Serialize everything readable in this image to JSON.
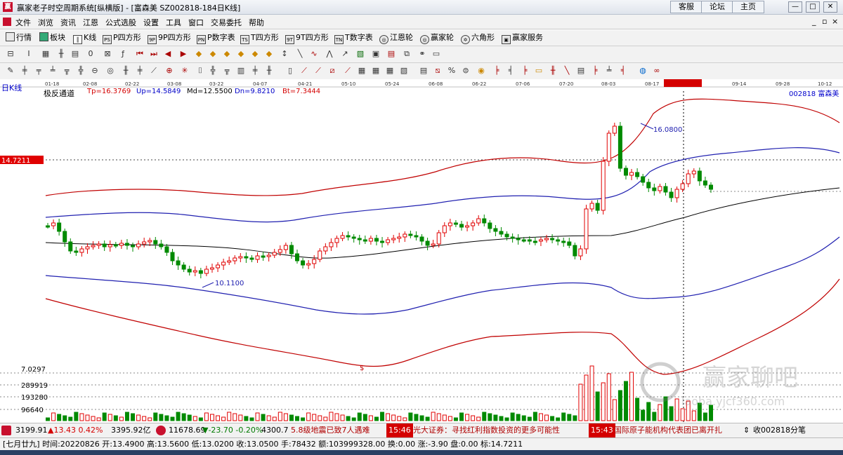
{
  "window": {
    "title": "赢家老子时空周期系统[纵横版] - [富森美  SZ002818-184日K线]",
    "buttons": [
      "客服",
      "论坛",
      "主页"
    ],
    "controls": [
      "—",
      "□",
      "✕"
    ]
  },
  "menu": [
    "文件",
    "浏览",
    "资讯",
    "江恩",
    "公式选股",
    "设置",
    "工具",
    "窗口",
    "交易委托",
    "帮助"
  ],
  "mdi_controls": [
    "_",
    "▫",
    "×"
  ],
  "toolbar1": [
    {
      "label": "行情",
      "icon": "grid-icon"
    },
    {
      "label": "板块",
      "icon": "blocks-icon"
    },
    {
      "label": "K线",
      "icon": "candle-icon"
    },
    {
      "label": "P四方形",
      "icon": "p-square-icon",
      "glyph": "PS"
    },
    {
      "label": "9P四方形",
      "icon": "9p-square-icon",
      "glyph": "9P"
    },
    {
      "label": "P数字表",
      "icon": "p-table-icon",
      "glyph": "PN"
    },
    {
      "label": "T四方形",
      "icon": "t-square-icon",
      "glyph": "TS"
    },
    {
      "label": "9T四方形",
      "icon": "9t-square-icon",
      "glyph": "9T"
    },
    {
      "label": "T数字表",
      "icon": "t-table-icon",
      "glyph": "TN"
    },
    {
      "label": "江恩轮",
      "icon": "gann-wheel-icon",
      "glyph": "◎"
    },
    {
      "label": "赢家轮",
      "icon": "winner-wheel-icon",
      "glyph": "◎"
    },
    {
      "label": "六角形",
      "icon": "hexagon-icon",
      "glyph": "✡"
    },
    {
      "label": "赢家服务",
      "icon": "service-icon",
      "glyph": "▣"
    }
  ],
  "chart": {
    "period_label": "日K线",
    "dates": [
      "01-18",
      "02-08",
      "02-22",
      "03-08",
      "03-22",
      "04-07",
      "04-21",
      "05-10",
      "05-24",
      "06-08",
      "06-22",
      "07-06",
      "07-20",
      "08-03",
      "08-17",
      "2022-08-26",
      "09-14",
      "09-28",
      "10-12"
    ],
    "indicator": {
      "name": "极反通道",
      "tp": "Tp=16.3769",
      "up": "Up=14.5849",
      "md": "Md=12.5500",
      "dn": "Dn=9.8210",
      "bt": "Bt=7.3444"
    },
    "stock_label": "002818  富森美",
    "price_marker": "14.7211",
    "high_label": "16.0800",
    "low_label": "10.1100",
    "price_axis_low": "7.0297",
    "volume_axis": [
      "289919",
      "193280",
      "96640"
    ],
    "s_marker": "$",
    "watermark_cn": "赢家聊吧",
    "watermark_url": "laoba.yjcf360.com"
  },
  "status": {
    "sh_index": "3199.91",
    "sh_change": "▲13.43 0.42%",
    "sh_amount": "3395.92亿",
    "sz_index": "11678.69",
    "sz_change": "▼-23.70 -0.20%",
    "sz_amount": "4300.7",
    "news1": "5.8级地震已致7人遇难",
    "time1": "15:46",
    "news2": "光大证券：寻找红利指数投资的更多可能性",
    "time2": "15:43",
    "news3": "国际原子能机构代表团已离开扎",
    "fav": "收002818分笔"
  },
  "info": "[七月廿九] 时间:20220826 开:13.4900 高:13.5600 低:13.0200 收:13.0500 手:78432 额:103999328.00 换:0.00 涨:-3.90 盘:0.00 标:14.7211",
  "colors": {
    "up": "#e00000",
    "down": "#008a00",
    "band_red": "#c00000",
    "band_blue": "#2020b0",
    "mid": "#000000"
  },
  "chart_data": {
    "type": "candlestick",
    "title": "富森美 SZ002818 日K线",
    "series": [
      {
        "name": "Tp",
        "last": 16.3769
      },
      {
        "name": "Up",
        "last": 14.5849
      },
      {
        "name": "Md",
        "last": 12.55
      },
      {
        "name": "Dn",
        "last": 9.821
      },
      {
        "name": "Bt",
        "last": 7.3444
      }
    ],
    "period_high": 16.08,
    "period_low": 10.11,
    "selected_bar": {
      "date": "20220826",
      "open": 13.49,
      "high": 13.56,
      "low": 13.02,
      "close": 13.05,
      "volume": 78432,
      "amount": 103999328.0
    },
    "volume_ticks": [
      289919,
      193280,
      96640
    ]
  }
}
